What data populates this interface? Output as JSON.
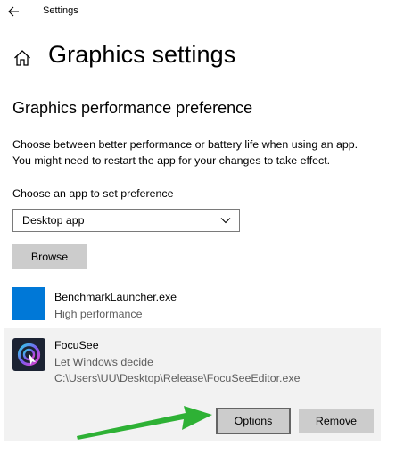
{
  "window": {
    "title": "Settings",
    "back_icon": "back-arrow-icon"
  },
  "header": {
    "home_icon": "home-icon",
    "title": "Graphics settings"
  },
  "section": {
    "title": "Graphics performance preference",
    "description_line1": "Choose between better performance or battery life when using an app.",
    "description_line2": "You might need to restart the app for your changes to take effect."
  },
  "app_picker": {
    "label": "Choose an app to set preference",
    "selected": "Desktop app",
    "browse_label": "Browse"
  },
  "apps": [
    {
      "name": "BenchmarkLauncher.exe",
      "preference": "High performance",
      "icon": "blue-tile-icon"
    },
    {
      "name": "FocuSee",
      "preference": "Let Windows decide",
      "path": "C:\\Users\\UU\\Desktop\\Release\\FocuSeeEditor.exe",
      "icon": "focusee-app-icon",
      "options_label": "Options",
      "remove_label": "Remove"
    }
  ],
  "colors": {
    "accent": "#0078d7",
    "button": "#cccccc",
    "selected_row": "#f2f2f2",
    "annotation_arrow": "#2eb135"
  }
}
